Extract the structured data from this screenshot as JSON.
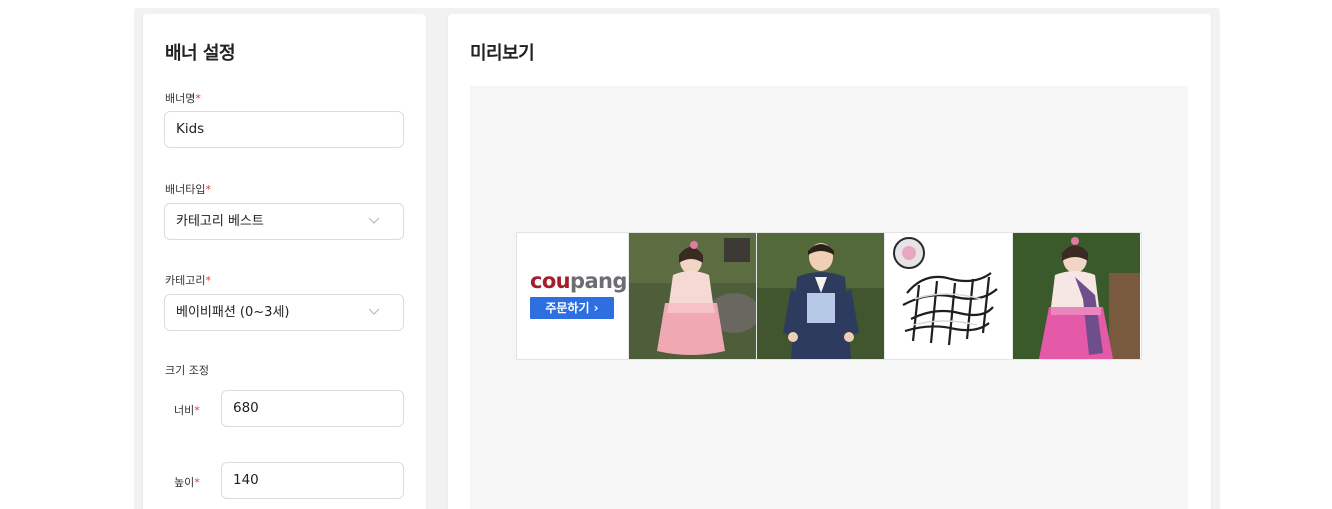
{
  "settings": {
    "title": "배너 설정",
    "banner_name": {
      "label": "배너명",
      "required": "*",
      "value": "Kids"
    },
    "banner_type": {
      "label": "배너타입",
      "required": "*",
      "value": "카테고리 베스트"
    },
    "category": {
      "label": "카테고리",
      "required": "*",
      "value": "베이비패션 (0~3세)"
    },
    "size": {
      "label": "크기 조정",
      "width": {
        "label": "너비",
        "required": "*",
        "value": "680"
      },
      "height": {
        "label": "높이",
        "required": "*",
        "value": "140"
      }
    }
  },
  "preview": {
    "title": "미리보기",
    "banner": {
      "logo_parts": [
        "cou",
        "pang"
      ],
      "order_button": "주문하기 ›",
      "products": [
        "hanbok-girl-sitting",
        "hanbok-boy",
        "hair-ties-bundle",
        "hanbok-girl-standing"
      ]
    }
  },
  "colors": {
    "required_mark": "#e23b3b",
    "order_button": "#2d6fe0",
    "logo_red": "#a51e2c",
    "logo_gray": "#6d6e71"
  }
}
